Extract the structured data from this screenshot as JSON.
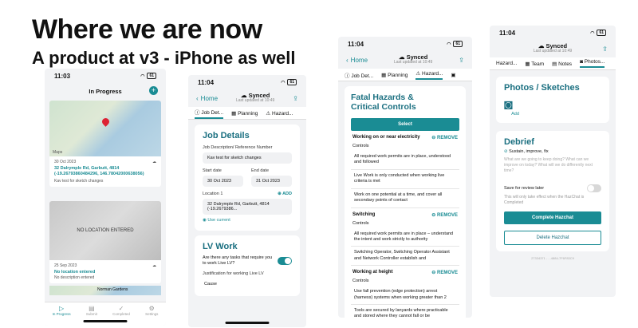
{
  "slide": {
    "title": "Where we are now",
    "subtitle": "A product at v3 - iPhone as well"
  },
  "phone1": {
    "time": "11:03",
    "battery": "61",
    "header_title": "In Progress",
    "map_footer": "Maps",
    "job1_date": "30 Oct 2023",
    "job1_address": "32 Dalrymple Rd, Garbutt, 4814 (-19.26793860484296, 146.78042000638056)",
    "job1_desc": "Kav test for sketch changes",
    "no_location_text": "NO LOCATION ENTERED",
    "job2_date": "25 Sep 2023",
    "job2_location": "No location entered",
    "job2_desc": "No description entered",
    "map_peek": "Norman Gardens",
    "tabs": [
      "In Progress",
      "Submit",
      "Completed",
      "Settings"
    ]
  },
  "phone2": {
    "time": "11:04",
    "battery": "61",
    "back": "Home",
    "sync_title": "Synced",
    "sync_sub": "Last updated at 10:49",
    "tabs": [
      "Job Det...",
      "Planning",
      "Hazard..."
    ],
    "section_title": "Job Details",
    "ref_label": "Job Description/ Reference Number",
    "ref_value": "Kav test for sketch changes",
    "start_label": "Start date",
    "start_value": "30 Oct 2023",
    "end_label": "End date",
    "end_value": "31 Oct 2023",
    "loc_label": "Location 1",
    "add": "ADD",
    "loc_value": "32 Dalrymple Rd, Garbutt, 4814 (-19.2679386...",
    "use_current": "Use current",
    "lv_title": "LV Work",
    "lv_question": "Are there any tasks that require you to work Live LV?",
    "justification_label": "Justification for working Live LV",
    "justification_value": "Cause"
  },
  "phone3": {
    "time": "11:04",
    "battery": "61",
    "back": "Home",
    "sync_title": "Synced",
    "sync_sub": "Last updated at 10:49",
    "tabs": [
      "Job Det...",
      "Planning",
      "Hazard..."
    ],
    "section_title_1": "Fatal Hazards &",
    "section_title_2": "Critical Controls",
    "select": "Select",
    "remove": "REMOVE",
    "controls": "Controls",
    "groups": [
      {
        "name": "Working on or near electricity",
        "items": [
          "All required work permits are in place, understood and followed",
          "Live Work is only conducted when working live criteria is met",
          "Work on one potential at a time, and cover all secondary points of contact"
        ]
      },
      {
        "name": "Switching",
        "items": [
          "All required work permits are in place – understand the intent and work strictly to authority",
          "Switching Operator, Switching Operator Assistant and Network Controller establish and"
        ]
      },
      {
        "name": "Working at height",
        "items": [
          "Use fall prevention (edge protection) arrest (harness) systems when working greater than 2",
          "Tools are secured by lanyards where practicable and stored where they cannot fall or be"
        ]
      }
    ]
  },
  "phone4": {
    "time": "11:04",
    "battery": "61",
    "sync_title": "Synced",
    "sync_sub": "Last updated at 10:49",
    "tabs": [
      "Hazard...",
      "Team",
      "Notes",
      "Photos..."
    ],
    "photos_title": "Photos / Sketches",
    "add": "Add",
    "debrief_title": "Debrief",
    "debrief_sub": "Sustain, improve, fix",
    "debrief_placeholder": "What are we going to keep doing? What can we improve on today? What will we do differently next time?",
    "review_label": "Save for review later",
    "review_note": "This will only take effect when the HazChat is Completed",
    "complete_btn": "Complete Hazchat",
    "delete_btn": "Delete Hazchat",
    "footer_code": "27334371 - ...4884-7F6F83C9"
  }
}
